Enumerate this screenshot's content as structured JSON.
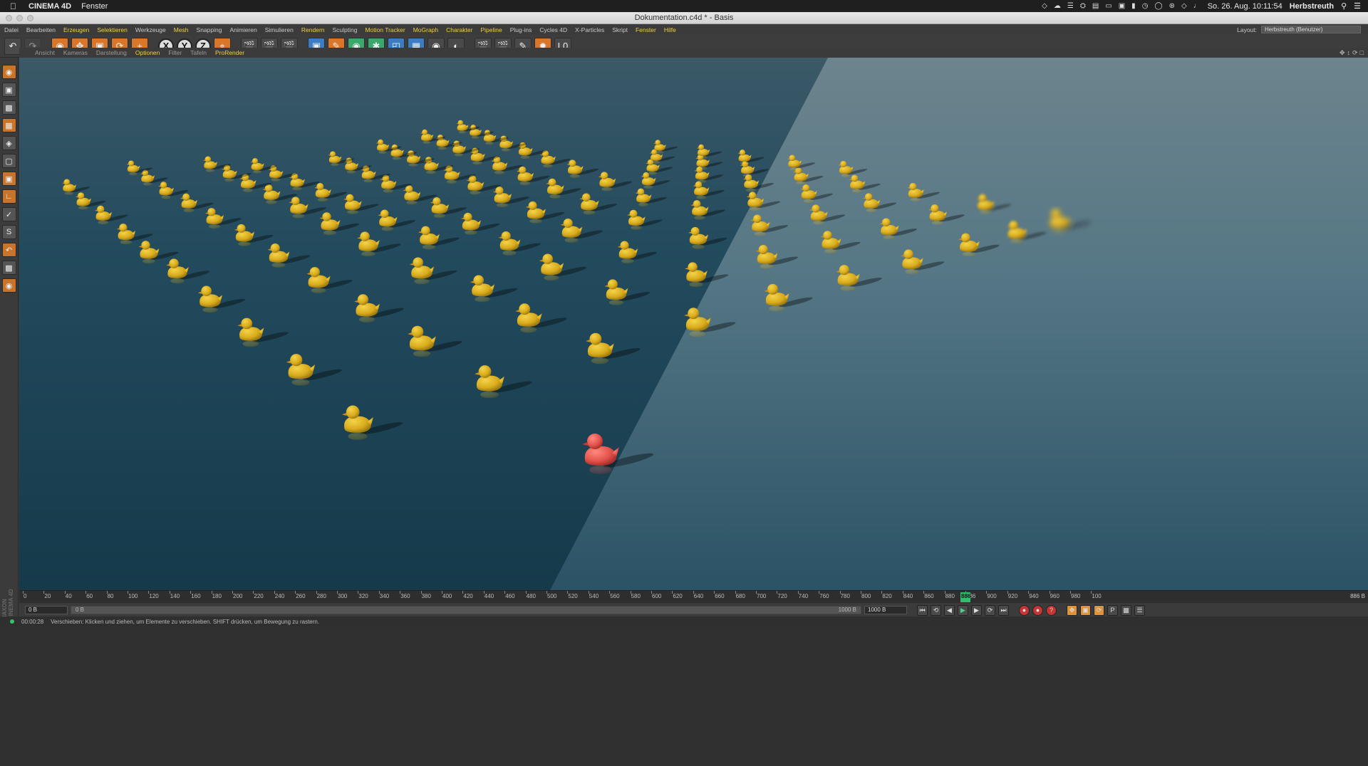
{
  "mac_menubar": {
    "app": "CINEMA 4D",
    "menu": "Fenster",
    "datetime": "So. 26. Aug.  10:11:54",
    "user": "Herbstreuth",
    "tray_icons": [
      "dropbox-icon",
      "cloud-icon",
      "stack-icon",
      "shield-icon",
      "script-icon",
      "display-icon",
      "cast-icon",
      "battery-icon",
      "time-machine-icon",
      "sync-icon",
      "bluetooth-icon",
      "wifi-icon",
      "volume-icon"
    ]
  },
  "window": {
    "title": "Dokumentation.c4d * - Basis"
  },
  "menubar": {
    "items": [
      {
        "label": "Datei",
        "hl": false
      },
      {
        "label": "Bearbeiten",
        "hl": false
      },
      {
        "label": "Erzeugen",
        "hl": true
      },
      {
        "label": "Selektieren",
        "hl": true
      },
      {
        "label": "Werkzeuge",
        "hl": false
      },
      {
        "label": "Mesh",
        "hl": true
      },
      {
        "label": "Snapping",
        "hl": false
      },
      {
        "label": "Animieren",
        "hl": false
      },
      {
        "label": "Simulieren",
        "hl": false
      },
      {
        "label": "Rendern",
        "hl": true
      },
      {
        "label": "Sculpting",
        "hl": false
      },
      {
        "label": "Motion Tracker",
        "hl": true
      },
      {
        "label": "MoGraph",
        "hl": true
      },
      {
        "label": "Charakter",
        "hl": true
      },
      {
        "label": "Pipeline",
        "hl": true
      },
      {
        "label": "Plug-ins",
        "hl": false
      },
      {
        "label": "Cycles 4D",
        "hl": false
      },
      {
        "label": "X-Particles",
        "hl": false
      },
      {
        "label": "Skript",
        "hl": false
      },
      {
        "label": "Fenster",
        "hl": true
      },
      {
        "label": "Hilfe",
        "hl": true
      }
    ],
    "layout_label": "Layout:",
    "layout_value": "Herbstreuth (Benutzer)"
  },
  "toolbar": {
    "tools": [
      "undo-icon",
      "redo-icon",
      "live-select-icon",
      "move-icon",
      "scale-icon",
      "rotate-icon",
      "add-icon"
    ],
    "axes": [
      "X",
      "Y",
      "Z"
    ],
    "render_tools": [
      "coordinate-system-icon",
      "render-view-icon",
      "render-picture-viewer-icon",
      "render-settings-icon",
      "cube-icon",
      "pen-icon",
      "subdivision-icon",
      "array-icon",
      "deformer-icon",
      "floor-icon",
      "camera-icon",
      "light-icon",
      "takes-icon",
      "clapper-icon",
      "brush-icon",
      "texture-icon",
      "level-icon"
    ]
  },
  "view_menu": {
    "items": [
      {
        "label": "Ansicht",
        "hl": false
      },
      {
        "label": "Kameras",
        "hl": false
      },
      {
        "label": "Darstellung",
        "hl": false
      },
      {
        "label": "Optionen",
        "hl": true
      },
      {
        "label": "Filter",
        "hl": false
      },
      {
        "label": "Tafeln",
        "hl": false
      },
      {
        "label": "ProRender",
        "hl": true
      }
    ]
  },
  "left_tools": [
    "make-editable-icon",
    "model-mode-icon",
    "texture-mode-icon",
    "workplane-icon",
    "points-mode-icon",
    "edges-mode-icon",
    "polygons-mode-icon",
    "axis-mode-icon",
    "tweak-mode-icon",
    "solo-icon",
    "snap-icon",
    "workplane-lock-icon",
    "sculpt-icon"
  ],
  "timeline": {
    "ticks": [
      "0",
      "20",
      "40",
      "60",
      "80",
      "100",
      "120",
      "140",
      "160",
      "180",
      "200",
      "220",
      "240",
      "260",
      "280",
      "300",
      "320",
      "340",
      "360",
      "380",
      "400",
      "420",
      "440",
      "460",
      "480",
      "500",
      "520",
      "540",
      "560",
      "580",
      "600",
      "620",
      "640",
      "660",
      "680",
      "700",
      "720",
      "740",
      "760",
      "780",
      "800",
      "820",
      "840",
      "860",
      "880",
      "886",
      "900",
      "920",
      "940",
      "960",
      "980",
      "100"
    ],
    "current_frame": "886",
    "end_label": "886 B"
  },
  "controls": {
    "start_field": "0 B",
    "range_left": "0 B",
    "range_right": "1000 B",
    "end_field": "1000 B"
  },
  "status": {
    "time": "00:00:28",
    "message": "Verschieben: Klicken und ziehen, um Elemente zu verschieben. SHIFT drücken, um Bewegung zu rastern."
  },
  "maxon_logo": "MAXON CINEMA 4D",
  "scene": {
    "ducks_color": "#e2b824",
    "hero_duck_color": "#e0504a",
    "floor_color_left": "#1e4456",
    "floor_color_right": "#5b7a86"
  }
}
